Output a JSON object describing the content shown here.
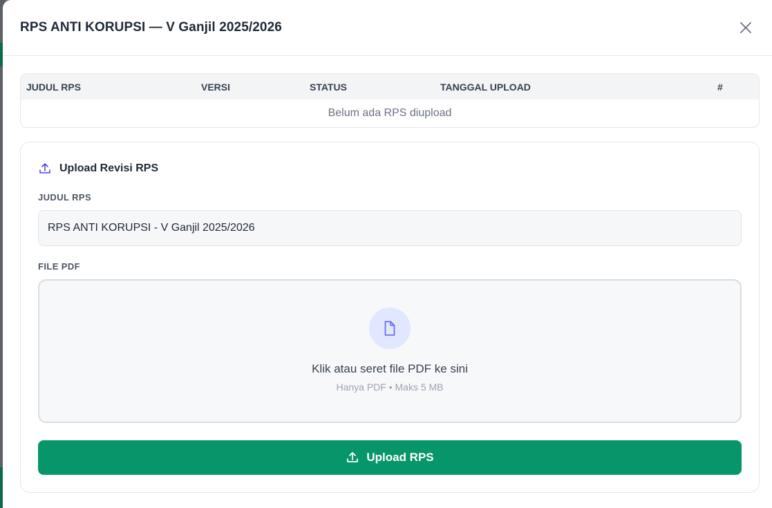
{
  "modal": {
    "title": "RPS ANTI KORUPSI — V Ganjil 2025/2026",
    "close_icon": "close-icon"
  },
  "table": {
    "columns": [
      "JUDUL RPS",
      "VERSI",
      "STATUS",
      "TANGGAL UPLOAD",
      "#"
    ],
    "empty_message": "Belum ada RPS diupload"
  },
  "upload": {
    "section_title": "Upload Revisi RPS",
    "section_icon": "upload-icon",
    "title_label": "JUDUL RPS",
    "title_value": "RPS ANTI KORUPSI - V Ganjil 2025/2026",
    "file_label": "FILE PDF",
    "dropzone_icon": "file-icon",
    "dropzone_text": "Klik atau seret file PDF ke sini",
    "dropzone_hint": "Hanya PDF • Maks 5 MB",
    "button_label": "Upload RPS"
  },
  "colors": {
    "primary_green": "#079669",
    "accent_indigo": "#6366f1",
    "icon_circle_bg": "#e0e7ff"
  }
}
